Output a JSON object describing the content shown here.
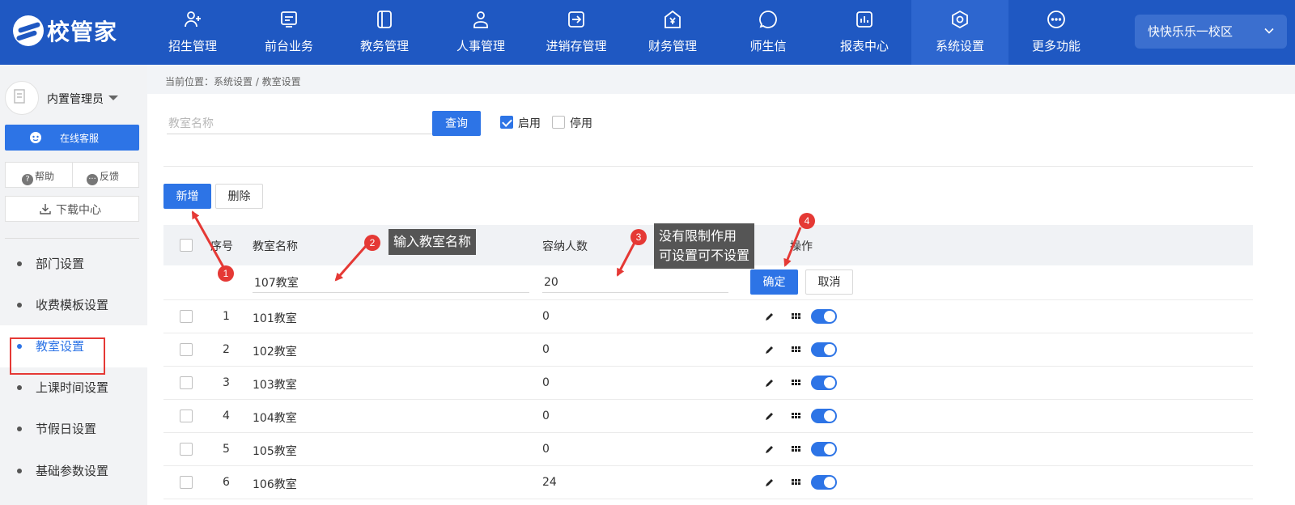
{
  "brand": {
    "name": "校管家"
  },
  "nav": [
    {
      "label": "招生管理",
      "icon": "user-plus-icon"
    },
    {
      "label": "前台业务",
      "icon": "desk-icon"
    },
    {
      "label": "教务管理",
      "icon": "book-icon"
    },
    {
      "label": "人事管理",
      "icon": "person-icon"
    },
    {
      "label": "进销存管理",
      "icon": "inventory-icon"
    },
    {
      "label": "财务管理",
      "icon": "yen-icon"
    },
    {
      "label": "师生信",
      "icon": "chat-icon"
    },
    {
      "label": "报表中心",
      "icon": "report-icon"
    },
    {
      "label": "系统设置",
      "icon": "settings-icon",
      "active": true
    },
    {
      "label": "更多功能",
      "icon": "more-icon"
    }
  ],
  "campus": {
    "label": "快快乐乐一校区"
  },
  "sidebar": {
    "username": "内置管理员",
    "service": "在线客服",
    "help": "帮助",
    "feedback": "反馈",
    "download": "下载中心",
    "menu": [
      {
        "label": "部门设置"
      },
      {
        "label": "收费模板设置"
      },
      {
        "label": "教室设置",
        "active": true
      },
      {
        "label": "上课时间设置"
      },
      {
        "label": "节假日设置"
      },
      {
        "label": "基础参数设置"
      }
    ]
  },
  "breadcrumb": "当前位置：系统设置 / 教室设置",
  "filter": {
    "placeholder": "教室名称",
    "query": "查询",
    "enabled_label": "启用",
    "enabled_checked": true,
    "disabled_label": "停用",
    "disabled_checked": false
  },
  "actions": {
    "add": "新增",
    "delete": "删除"
  },
  "table": {
    "headers": {
      "index": "序号",
      "name": "教室名称",
      "capacity": "容纳人数",
      "ops": "操作"
    },
    "new_row": {
      "name": "107教室",
      "capacity": "20",
      "confirm": "确定",
      "cancel": "取消"
    },
    "rows": [
      {
        "index": "1",
        "name": "101教室",
        "capacity": "0"
      },
      {
        "index": "2",
        "name": "102教室",
        "capacity": "0"
      },
      {
        "index": "3",
        "name": "103教室",
        "capacity": "0"
      },
      {
        "index": "4",
        "name": "104教室",
        "capacity": "0"
      },
      {
        "index": "5",
        "name": "105教室",
        "capacity": "0"
      },
      {
        "index": "6",
        "name": "106教室",
        "capacity": "24"
      }
    ]
  },
  "annotations": {
    "n1": "1",
    "n2": "2",
    "n3": "3",
    "n4": "4",
    "tip2": "输入教室名称",
    "tip3_line1": "没有限制作用",
    "tip3_line2": "可设置可不设置"
  },
  "colors": {
    "nav_bg": "#1f58c2",
    "accent": "#2d74e6",
    "annotation": "#e53935"
  }
}
